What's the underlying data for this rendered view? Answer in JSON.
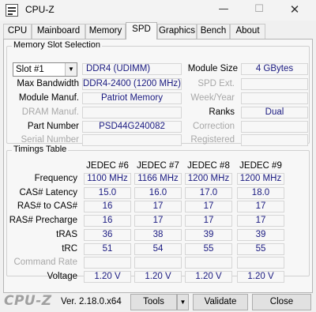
{
  "window": {
    "title": "CPU-Z",
    "minimize_glyph": "—",
    "maximize_glyph": "☐",
    "close_glyph": "✕"
  },
  "tabs": [
    "CPU",
    "Mainboard",
    "Memory",
    "SPD",
    "Graphics",
    "Bench",
    "About"
  ],
  "active_tab": "SPD",
  "memory_slot": {
    "group_title": "Memory Slot Selection",
    "slot_value": "Slot #1",
    "type": "DDR4 (UDIMM)",
    "labels": {
      "module_size": "Module Size",
      "max_bandwidth": "Max Bandwidth",
      "spd_ext": "SPD Ext.",
      "module_manuf": "Module Manuf.",
      "week_year": "Week/Year",
      "dram_manuf": "DRAM Manuf.",
      "ranks": "Ranks",
      "part_number": "Part Number",
      "correction": "Correction",
      "serial_number": "Serial Number",
      "registered": "Registered"
    },
    "values": {
      "module_size": "4 GBytes",
      "max_bandwidth": "DDR4-2400 (1200 MHz)",
      "spd_ext": "",
      "module_manuf": "Patriot Memory",
      "week_year": "",
      "dram_manuf": "",
      "ranks": "Dual",
      "part_number": "PSD44G240082",
      "correction": "",
      "serial_number": "",
      "registered": ""
    }
  },
  "timings": {
    "group_title": "Timings Table",
    "columns": [
      "JEDEC #6",
      "JEDEC #7",
      "JEDEC #8",
      "JEDEC #9"
    ],
    "rows": [
      {
        "label": "Frequency",
        "disabled": false,
        "values": [
          "1100 MHz",
          "1166 MHz",
          "1200 MHz",
          "1200 MHz"
        ]
      },
      {
        "label": "CAS# Latency",
        "disabled": false,
        "values": [
          "15.0",
          "16.0",
          "17.0",
          "18.0"
        ]
      },
      {
        "label": "RAS# to CAS#",
        "disabled": false,
        "values": [
          "16",
          "17",
          "17",
          "17"
        ]
      },
      {
        "label": "RAS# Precharge",
        "disabled": false,
        "values": [
          "16",
          "17",
          "17",
          "17"
        ]
      },
      {
        "label": "tRAS",
        "disabled": false,
        "values": [
          "36",
          "38",
          "39",
          "39"
        ]
      },
      {
        "label": "tRC",
        "disabled": false,
        "values": [
          "51",
          "54",
          "55",
          "55"
        ]
      },
      {
        "label": "Command Rate",
        "disabled": true,
        "values": [
          "",
          "",
          "",
          ""
        ]
      },
      {
        "label": "Voltage",
        "disabled": false,
        "values": [
          "1.20 V",
          "1.20 V",
          "1.20 V",
          "1.20 V"
        ]
      }
    ]
  },
  "footer": {
    "logo": "CPU-Z",
    "version": "Ver. 2.18.0.x64",
    "tools_label": "Tools",
    "validate_label": "Validate",
    "close_label": "Close"
  },
  "colors": {
    "value_text": "#1a1a80",
    "disabled_label": "#a8a8a8"
  }
}
